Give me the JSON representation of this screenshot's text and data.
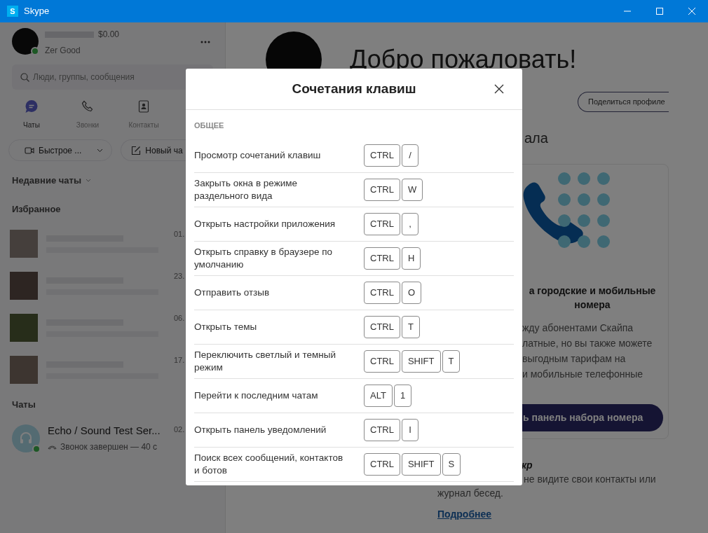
{
  "window": {
    "logo_letter": "S",
    "title": "Skype"
  },
  "sidebar": {
    "profile": {
      "balance": "$0.00",
      "name": "Zer Good",
      "online": true
    },
    "search": {
      "placeholder": "Люди, группы, сообщения"
    },
    "nav_tabs": [
      {
        "label": "Чаты",
        "kind": "chats",
        "selected": true
      },
      {
        "label": "Звонки",
        "kind": "calls",
        "selected": false
      },
      {
        "label": "Контакты",
        "kind": "contacts",
        "selected": false
      }
    ],
    "actions": [
      {
        "label": "Быстрое ...",
        "kind": "meet"
      },
      {
        "label": "Новый ча",
        "kind": "compose"
      }
    ],
    "recent_header": "Недавние чаты",
    "favourites_header": "Избранное",
    "favourites": [
      {
        "date": "01."
      },
      {
        "date": "23."
      },
      {
        "date": "06."
      },
      {
        "date": "17."
      }
    ],
    "chats_header": "Чаты",
    "chats": [
      {
        "name": "Echo / Sound Test Ser...",
        "status": "Звонок завершен — 40 с",
        "date": "02.",
        "online": true
      }
    ]
  },
  "main": {
    "welcome_title": "Добро пожаловать!",
    "share_button": "Поделиться профиле",
    "section_fragment": "ала",
    "card": {
      "title_lines": [
        "а городские и мобильные",
        "номера"
      ],
      "body_lines": [
        "жду абонентами Скайпа",
        "латные, но вы также можете",
        "выгодным тарифам на",
        "и мобильные телефонные"
      ],
      "button": "ь панель набора номера"
    },
    "note": {
      "title": "кр",
      "lines": [
        "не видите свои контакты или",
        "журнал бесед."
      ],
      "link": "Подробнее"
    }
  },
  "dialog": {
    "title": "Сочетания клавиш",
    "section": "ОБЩЕЕ",
    "shortcuts": [
      {
        "action": "Просмотр сочетаний клавиш",
        "keys": [
          "CTRL",
          "/"
        ]
      },
      {
        "action": "Закрыть окна в режиме раздельного вида",
        "keys": [
          "CTRL",
          "W"
        ]
      },
      {
        "action": "Открыть настройки приложения",
        "keys": [
          "CTRL",
          ","
        ]
      },
      {
        "action": "Открыть справку в браузере по умолчанию",
        "keys": [
          "CTRL",
          "H"
        ]
      },
      {
        "action": "Отправить отзыв",
        "keys": [
          "CTRL",
          "O"
        ]
      },
      {
        "action": "Открыть темы",
        "keys": [
          "CTRL",
          "T"
        ]
      },
      {
        "action": "Переключить светлый и темный режим",
        "keys": [
          "CTRL",
          "SHIFT",
          "T"
        ]
      },
      {
        "action": "Перейти к последним чатам",
        "keys": [
          "ALT",
          "1"
        ]
      },
      {
        "action": "Открыть панель уведомлений",
        "keys": [
          "CTRL",
          "I"
        ]
      },
      {
        "action": "Поиск всех сообщений, контактов и ботов",
        "keys": [
          "CTRL",
          "SHIFT",
          "S"
        ]
      }
    ]
  }
}
